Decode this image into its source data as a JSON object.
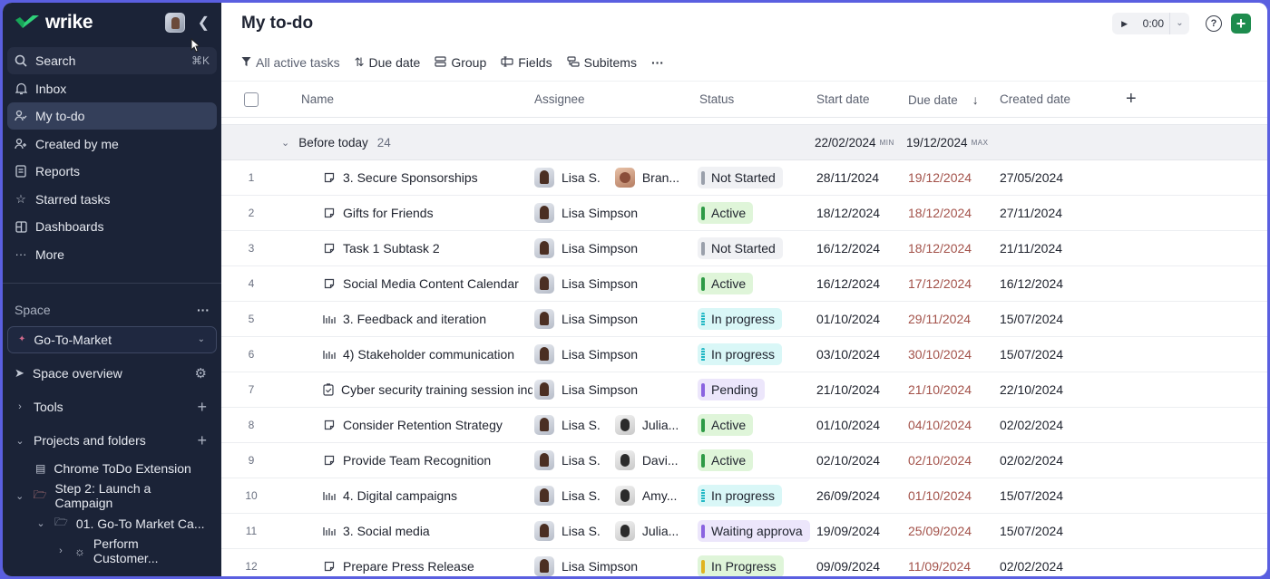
{
  "app": {
    "name": "wrike"
  },
  "sidebar": {
    "search_label": "Search",
    "search_shortcut": "⌘K",
    "nav": [
      {
        "label": "Inbox",
        "icon": "bell-icon"
      },
      {
        "label": "My to-do",
        "icon": "user-check-icon",
        "active": true
      },
      {
        "label": "Created by me",
        "icon": "user-plus-icon"
      },
      {
        "label": "Reports",
        "icon": "report-icon"
      },
      {
        "label": "Starred tasks",
        "icon": "star-icon"
      },
      {
        "label": "Dashboards",
        "icon": "dashboard-icon"
      },
      {
        "label": "More",
        "icon": "more-icon"
      }
    ],
    "space_label": "Space",
    "space_selected": "Go-To-Market",
    "tree": {
      "space_overview": "Space overview",
      "tools": "Tools",
      "projects": "Projects and folders",
      "chrome_todo": "Chrome ToDo Extension",
      "step2": "Step 2: Launch a Campaign",
      "gtm": "01. Go-To Market Ca...",
      "perform": "Perform Customer..."
    }
  },
  "header": {
    "title": "My to-do",
    "timer": "0:00"
  },
  "toolbar": {
    "filter": "All active tasks",
    "sort": "Due date",
    "group": "Group",
    "fields": "Fields",
    "subitems": "Subitems",
    "more": "···"
  },
  "table": {
    "columns": {
      "name": "Name",
      "assignee": "Assignee",
      "status": "Status",
      "start": "Start date",
      "due": "Due date",
      "created": "Created date"
    },
    "group": {
      "label": "Before today",
      "count": "24",
      "start": "22/02/2024",
      "start_mini": "MIN",
      "due": "19/12/2024",
      "due_mini": "MAX"
    },
    "rows": [
      {
        "n": "1",
        "type": "task",
        "name": "3. Secure Sponsorships",
        "a1": "Lisa S.",
        "a2": "Bran...",
        "a2_av": "bran",
        "status": "Not Started",
        "st": "notstarted",
        "start": "28/11/2024",
        "due": "19/12/2024",
        "created": "27/05/2024"
      },
      {
        "n": "2",
        "type": "task",
        "name": "Gifts for Friends",
        "a1": "Lisa Simpson",
        "a2": "",
        "status": "Active",
        "st": "active",
        "start": "18/12/2024",
        "due": "18/12/2024",
        "created": "27/11/2024"
      },
      {
        "n": "3",
        "type": "task",
        "name": "Task 1 Subtask 2",
        "a1": "Lisa Simpson",
        "a2": "",
        "status": "Not Started",
        "st": "notstarted",
        "start": "16/12/2024",
        "due": "18/12/2024",
        "created": "21/11/2024"
      },
      {
        "n": "4",
        "type": "task",
        "name": "Social Media Content Calendar",
        "a1": "Lisa Simpson",
        "a2": "",
        "status": "Active",
        "st": "active",
        "start": "16/12/2024",
        "due": "17/12/2024",
        "created": "16/12/2024"
      },
      {
        "n": "5",
        "type": "project",
        "name": "3. Feedback and iteration",
        "a1": "Lisa Simpson",
        "a2": "",
        "status": "In progress",
        "st": "progress",
        "start": "01/10/2024",
        "due": "29/11/2024",
        "created": "15/07/2024"
      },
      {
        "n": "6",
        "type": "project",
        "name": "4) Stakeholder communication",
        "a1": "Lisa Simpson",
        "a2": "",
        "status": "In progress",
        "st": "progress",
        "start": "03/10/2024",
        "due": "30/10/2024",
        "created": "15/07/2024"
      },
      {
        "n": "7",
        "type": "approval",
        "name": "Cyber security training session inq",
        "a1": "Lisa Simpson",
        "a2": "",
        "status": "Pending",
        "st": "pending",
        "start": "21/10/2024",
        "due": "21/10/2024",
        "created": "22/10/2024"
      },
      {
        "n": "8",
        "type": "task",
        "name": "Consider Retention Strategy",
        "a1": "Lisa S.",
        "a2": "Julia...",
        "a2_av": "other",
        "status": "Active",
        "st": "active",
        "start": "01/10/2024",
        "due": "04/10/2024",
        "created": "02/02/2024"
      },
      {
        "n": "9",
        "type": "task",
        "name": "Provide Team Recognition",
        "a1": "Lisa S.",
        "a2": "Davi...",
        "a2_av": "other",
        "status": "Active",
        "st": "active",
        "start": "02/10/2024",
        "due": "02/10/2024",
        "created": "02/02/2024"
      },
      {
        "n": "10",
        "type": "project",
        "name": "4. Digital campaigns",
        "a1": "Lisa S.",
        "a2": "Amy...",
        "a2_av": "other",
        "status": "In progress",
        "st": "progress",
        "start": "26/09/2024",
        "due": "01/10/2024",
        "created": "15/07/2024"
      },
      {
        "n": "11",
        "type": "project",
        "name": "3. Social media",
        "a1": "Lisa S.",
        "a2": "Julia...",
        "a2_av": "other",
        "status": "Waiting approva",
        "st": "waiting",
        "start": "19/09/2024",
        "due": "25/09/2024",
        "created": "15/07/2024"
      },
      {
        "n": "12",
        "type": "task",
        "name": "Prepare Press Release",
        "a1": "Lisa Simpson",
        "a2": "",
        "status": "In Progress",
        "st": "inprog2",
        "start": "09/09/2024",
        "due": "11/09/2024",
        "created": "02/02/2024"
      }
    ]
  },
  "colors": {
    "sidebar_bg": "#1b2337",
    "accent_green": "#1e8c4e",
    "due_text": "#a3524a",
    "frame": "#5a5fe0"
  }
}
